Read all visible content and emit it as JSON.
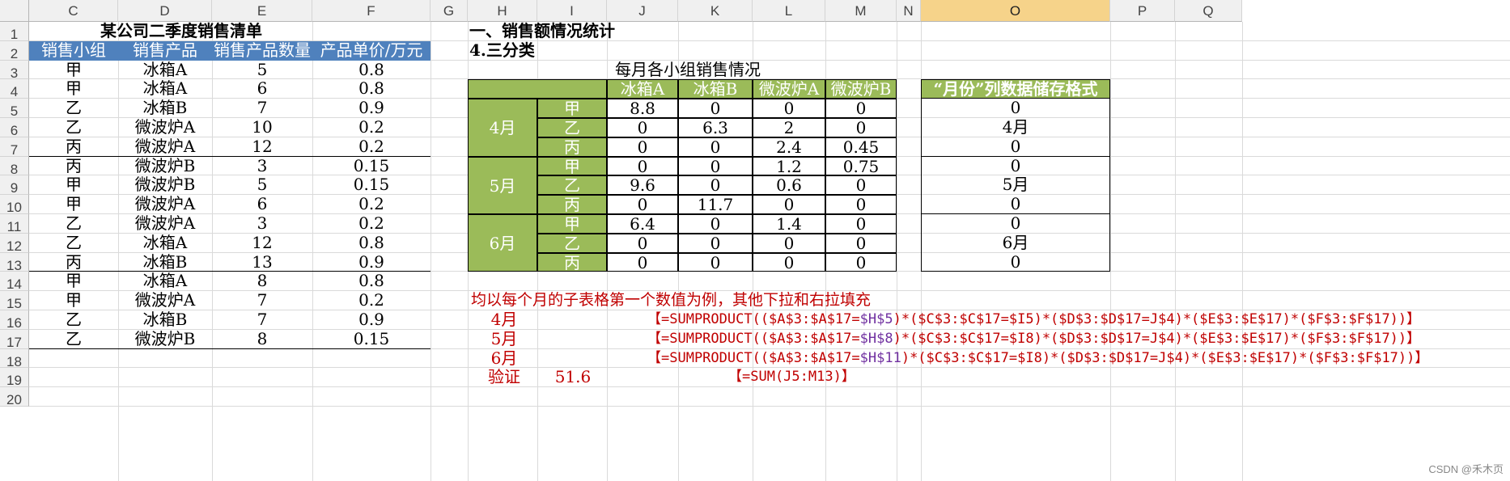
{
  "columns": [
    "C",
    "D",
    "E",
    "F",
    "G",
    "H",
    "I",
    "J",
    "K",
    "L",
    "M",
    "N",
    "O",
    "P",
    "Q"
  ],
  "selected_column": "O",
  "rows": [
    "1",
    "2",
    "3",
    "4",
    "5",
    "6",
    "7",
    "8",
    "9",
    "10",
    "11",
    "12",
    "13",
    "14",
    "15",
    "16",
    "17",
    "18",
    "19",
    "20"
  ],
  "left_table": {
    "title": "某公司二季度销售清单",
    "headers": [
      "销售小组",
      "销售产品",
      "销售产品数量",
      "产品单价/万元"
    ],
    "data": [
      [
        "甲",
        "冰箱A",
        "5",
        "0.8"
      ],
      [
        "甲",
        "冰箱A",
        "6",
        "0.8"
      ],
      [
        "乙",
        "冰箱B",
        "7",
        "0.9"
      ],
      [
        "乙",
        "微波炉A",
        "10",
        "0.2"
      ],
      [
        "丙",
        "微波炉A",
        "12",
        "0.2"
      ],
      [
        "丙",
        "微波炉B",
        "3",
        "0.15"
      ],
      [
        "甲",
        "微波炉B",
        "5",
        "0.15"
      ],
      [
        "甲",
        "微波炉A",
        "6",
        "0.2"
      ],
      [
        "乙",
        "微波炉A",
        "3",
        "0.2"
      ],
      [
        "乙",
        "冰箱A",
        "12",
        "0.8"
      ],
      [
        "丙",
        "冰箱B",
        "13",
        "0.9"
      ],
      [
        "甲",
        "冰箱A",
        "8",
        "0.8"
      ],
      [
        "甲",
        "微波炉A",
        "7",
        "0.2"
      ],
      [
        "乙",
        "冰箱B",
        "7",
        "0.9"
      ],
      [
        "乙",
        "微波炉B",
        "8",
        "0.15"
      ]
    ]
  },
  "right": {
    "section_title": "一、销售额情况统计",
    "subtitle": "4.三分类",
    "table_caption": "每月各小组销售情况",
    "products": [
      "冰箱A",
      "冰箱B",
      "微波炉A",
      "微波炉B"
    ],
    "months": [
      {
        "label": "4月",
        "rows": [
          [
            "甲",
            "8.8",
            "0",
            "0",
            "0"
          ],
          [
            "乙",
            "0",
            "6.3",
            "2",
            "0"
          ],
          [
            "丙",
            "0",
            "0",
            "2.4",
            "0.45"
          ]
        ]
      },
      {
        "label": "5月",
        "rows": [
          [
            "甲",
            "0",
            "0",
            "1.2",
            "0.75"
          ],
          [
            "乙",
            "9.6",
            "0",
            "0.6",
            "0"
          ],
          [
            "丙",
            "0",
            "11.7",
            "0",
            "0"
          ]
        ]
      },
      {
        "label": "6月",
        "rows": [
          [
            "甲",
            "6.4",
            "0",
            "1.4",
            "0"
          ],
          [
            "乙",
            "0",
            "0",
            "0",
            "0"
          ],
          [
            "丙",
            "0",
            "0",
            "0",
            "0"
          ]
        ]
      }
    ],
    "storage_header": "“月份”列数据储存格式",
    "storage_values": [
      "0",
      "4月",
      "0",
      "0",
      "5月",
      "0",
      "0",
      "6月",
      "0"
    ],
    "note": "均以每个月的子表格第一个数值为例，其他下拉和右拉填充",
    "formulas": [
      {
        "month": "4月",
        "pre": "【=SUMPRODUCT(($A$3:$A$17=",
        "ref": "$H$5",
        "post": ")*($C$3:$C$17=$I5)*($D$3:$D$17=J$4)*($E$3:$E$17)*($F$3:$F$17))】"
      },
      {
        "month": "5月",
        "pre": "【=SUMPRODUCT(($A$3:$A$17=",
        "ref": "$H$8",
        "post": ")*($C$3:$C$17=$I8)*($D$3:$D$17=J$4)*($E$3:$E$17)*($F$3:$F$17))】"
      },
      {
        "month": "6月",
        "pre": "【=SUMPRODUCT(($A$3:$A$17=",
        "ref": "$H$11",
        "post": ")*($C$3:$C$17=$I8)*($D$3:$D$17=J$4)*($E$3:$E$17)*($F$3:$F$17))】"
      }
    ],
    "verify_label": "验证",
    "verify_value": "51.6",
    "verify_formula": "【=SUM(J5:M13)】"
  },
  "watermark": "CSDN @禾木页"
}
